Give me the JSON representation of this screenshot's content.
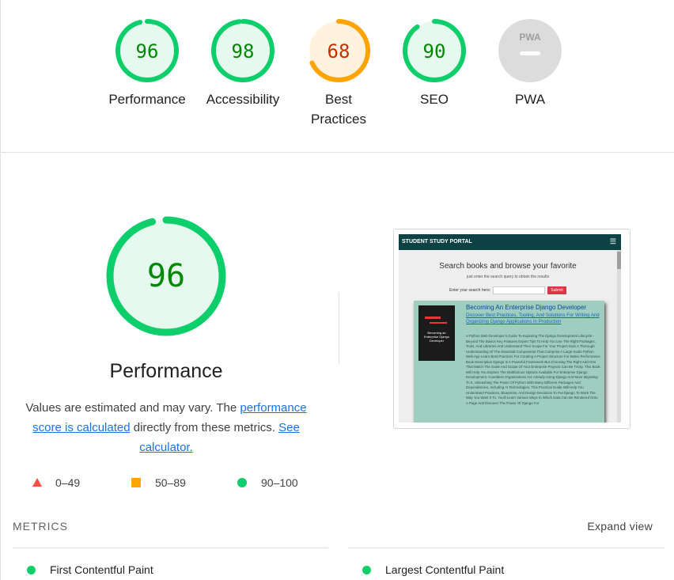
{
  "categories": [
    {
      "label": "Performance",
      "score": "96",
      "value": 96,
      "status": "pass"
    },
    {
      "label": "Accessibility",
      "score": "98",
      "value": 98,
      "status": "pass"
    },
    {
      "label_line1": "Best",
      "label_line2": "Practices",
      "score": "68",
      "value": 68,
      "status": "average"
    },
    {
      "label": "SEO",
      "score": "90",
      "value": 90,
      "status": "pass"
    },
    {
      "label": "PWA",
      "badge": "PWA",
      "status": "na"
    }
  ],
  "performance": {
    "score": "96",
    "value": 96,
    "title": "Performance",
    "desc_prefix": "Values are estimated and may vary. The ",
    "desc_link1": "performance score is calculated",
    "desc_middle": " directly from these metrics. ",
    "desc_link2": "See calculator.",
    "legend": [
      {
        "label": "0–49",
        "shape": "triangle"
      },
      {
        "label": "50–89",
        "shape": "square"
      },
      {
        "label": "90–100",
        "shape": "circle"
      }
    ]
  },
  "screenshot": {
    "brand": "STUDENT STUDY PORTAL",
    "menu_icon": "hamburger-icon",
    "heading": "Search books and browse your favorite",
    "subheading": "just enter the search query to obtain the results",
    "search_label": "Enter your search here:",
    "submit": "Submit",
    "book_cover": "Becoming an Enterprise Django Developer",
    "book_title": "Becoming An Enterprise Django Developer",
    "book_subtitle": "Discover Best Practices, Tooling, And Solutions For Writing And Organizing Django Applications In Production",
    "book_desc": "A Python Web Developer's Guide To Exploring The Django Development Lifecycle - Beyond The Basics Key Features Expert Tips To Help You Use The Right Packages, Tools, And Libraries And Understand Their Scope For Your Project Gain A Thorough Understanding Of The Essential Components That Comprise A Large-Scale Python Web App Learn Best Practices For Creating A Project Structure For Better Performance Book Description Django Is A Powerful Framework But Choosing The Right Add-Ons That Match The Scale And Scope Of Your Enterprise Projects Can Be Tricky. This Book Will Help You Explore The Multifarious Options Available For Enterprise Django Development. Countless Organizations Are Already Using Django And More Migrating To It, Unleashing The Power Of Python With Many Different Packages And Dependencies, Including AI Technologies. This Practical Guide Will Help You Understand Practices, Blueprints, And Design Decisions To Put Django To Work The Way You Want It To. You'll Learn Various Ways In Which Data Can Be Rendered Onto A Page And Discover The Power Of Django For"
  },
  "metrics": {
    "heading": "METRICS",
    "expand": "Expand view",
    "items": [
      {
        "label": "First Contentful Paint",
        "status": "pass"
      },
      {
        "label": "Largest Contentful Paint",
        "status": "pass"
      }
    ]
  },
  "colors": {
    "pass": "#0cce6b",
    "pass_text": "#008800",
    "pass_bg": "#e5f9ee",
    "average": "#ffa400",
    "average_text": "#c33300",
    "average_bg": "#fff3e0",
    "fail": "#ff4e42",
    "na": "#dcdcdc"
  }
}
